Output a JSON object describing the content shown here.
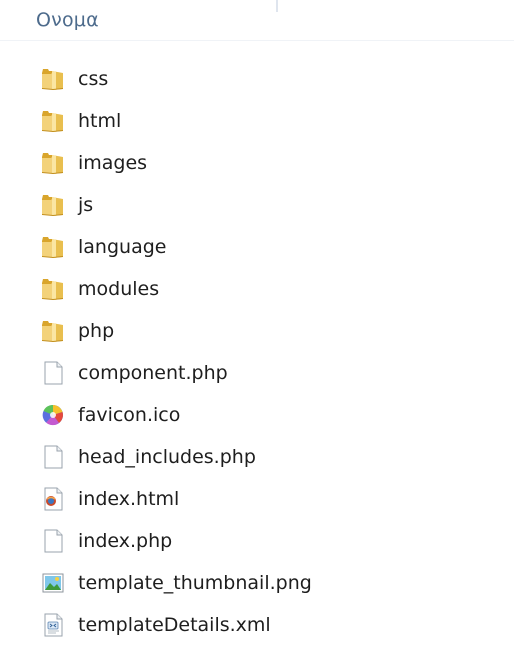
{
  "header": {
    "name_column_label": "Ονομα"
  },
  "items": [
    {
      "name": "css",
      "icon": "folder-icon",
      "type": "folder"
    },
    {
      "name": "html",
      "icon": "folder-icon",
      "type": "folder"
    },
    {
      "name": "images",
      "icon": "folder-icon",
      "type": "folder"
    },
    {
      "name": "js",
      "icon": "folder-icon",
      "type": "folder"
    },
    {
      "name": "language",
      "icon": "folder-icon",
      "type": "folder"
    },
    {
      "name": "modules",
      "icon": "folder-icon",
      "type": "folder"
    },
    {
      "name": "php",
      "icon": "folder-icon",
      "type": "folder"
    },
    {
      "name": "component.php",
      "icon": "document-icon",
      "type": "file"
    },
    {
      "name": "favicon.ico",
      "icon": "color-wheel-icon",
      "type": "file"
    },
    {
      "name": "head_includes.php",
      "icon": "document-icon",
      "type": "file"
    },
    {
      "name": "index.html",
      "icon": "html-file-icon",
      "type": "file"
    },
    {
      "name": "index.php",
      "icon": "document-icon",
      "type": "file"
    },
    {
      "name": "template_thumbnail.png",
      "icon": "image-file-icon",
      "type": "file"
    },
    {
      "name": "templateDetails.xml",
      "icon": "xml-file-icon",
      "type": "file"
    }
  ],
  "colors": {
    "header_text": "#4d6b8c",
    "item_text": "#1e1e1e",
    "folder": "#e8c35a"
  }
}
